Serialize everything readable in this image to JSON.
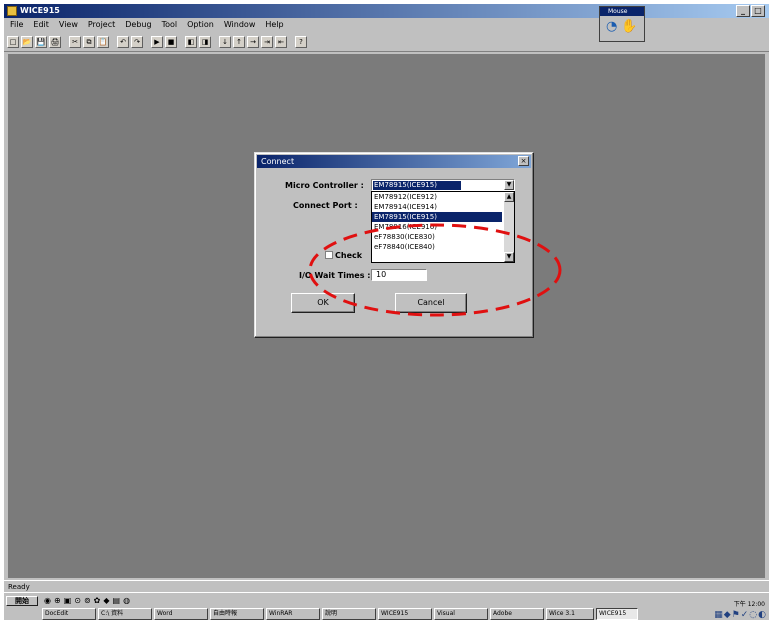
{
  "window": {
    "title": "WICE915",
    "min": "_",
    "max": "□",
    "close": "×"
  },
  "menu": [
    "File",
    "Edit",
    "View",
    "Project",
    "Debug",
    "Tool",
    "Option",
    "Window",
    "Help"
  ],
  "toolbar": {
    "buttons": [
      "□",
      "📂",
      "💾",
      "🖨",
      "✂",
      "⧉",
      "📋",
      "↶",
      "↷",
      "▶",
      "■",
      "◧",
      "◨",
      "↓",
      "↑",
      "→",
      "⇥",
      "⇤",
      "?"
    ]
  },
  "palette": {
    "title": "Mouse",
    "icon_a": "◔",
    "icon_b": "✋"
  },
  "dialog": {
    "title": "Connect",
    "close": "×",
    "micro_controller_label": "Micro Controller :",
    "micro_controller_value": "EM78915(ICE915)",
    "connect_port_label": "Connect  Port  :",
    "check_label": "Check",
    "io_wait_label": "I/O Wait Times :",
    "io_wait_value": "10",
    "ok_label": "OK",
    "cancel_label": "Cancel",
    "dropdown_items": [
      "EM78912(ICE912)",
      "EM78914(ICE914)",
      "EM78915(ICE915)",
      "EM78916(ICE916)",
      "eF78830(ICE830)",
      "eF78840(ICE840)"
    ],
    "selected_index": 2
  },
  "status": {
    "text": "Ready"
  },
  "taskbar": {
    "start": "開始",
    "quick_launch": [
      "◉",
      "⊕",
      "▣",
      "⊙",
      "⊚",
      "✿",
      "◆",
      "▤",
      "◍"
    ],
    "tasks": [
      "DocEdit",
      "C:\\ 資料",
      "Word",
      "自由時報",
      "WinRAR",
      "說明",
      "WICE915",
      "Visual",
      "Adobe",
      "Wice 3.1",
      "WICE915"
    ],
    "active_task_index": 10,
    "clock": "下午 12:00",
    "tray": "▦◆⚑✓◌◐"
  },
  "colors": {
    "annotation": "#e01010",
    "selection": "#0a246a",
    "desktop": "#7b7b7b"
  }
}
